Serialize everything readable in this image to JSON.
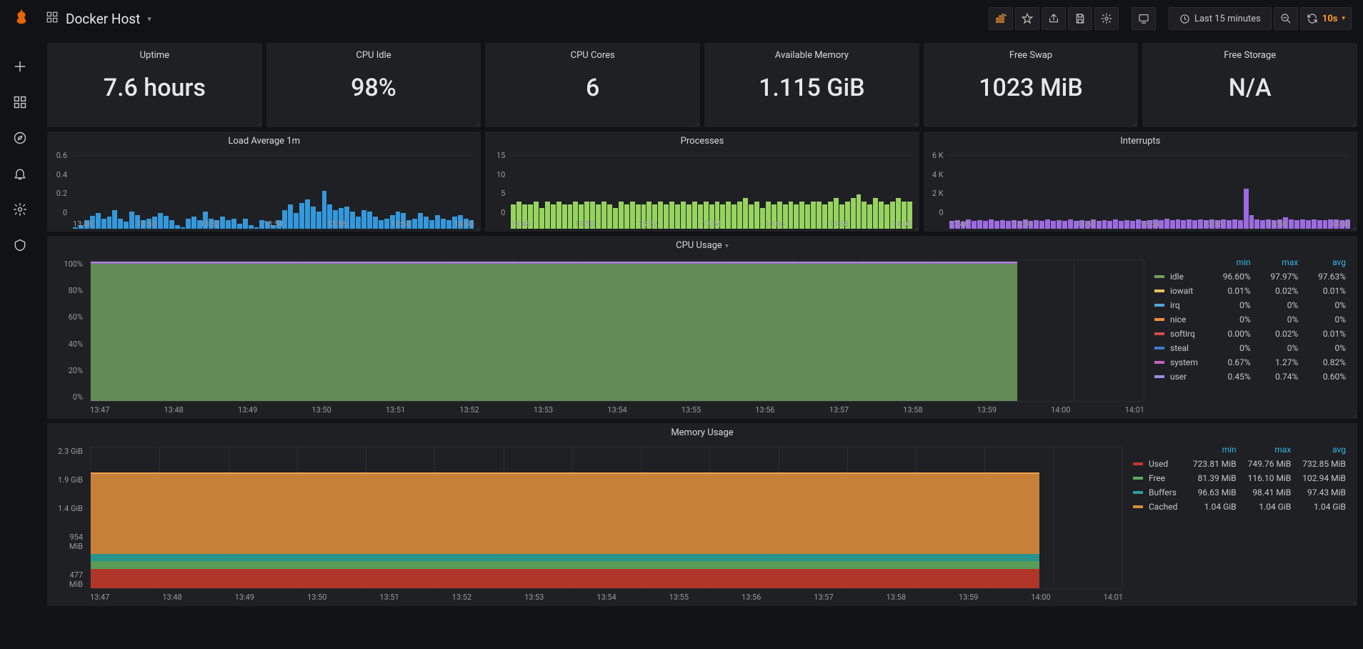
{
  "header": {
    "dashboard_title": "Docker Host",
    "time_range": "Last 15 minutes",
    "refresh_interval": "10s"
  },
  "stats": [
    {
      "title": "Uptime",
      "value": "7.6 hours"
    },
    {
      "title": "CPU Idle",
      "value": "98%"
    },
    {
      "title": "CPU Cores",
      "value": "6"
    },
    {
      "title": "Available Memory",
      "value": "1.115 GiB"
    },
    {
      "title": "Free Swap",
      "value": "1023 MiB"
    },
    {
      "title": "Free Storage",
      "value": "N/A"
    }
  ],
  "mini_panels": [
    {
      "title": "Load Average 1m",
      "color": "#3498db",
      "y_ticks": [
        "0",
        "0.2",
        "0.4",
        "0.6"
      ],
      "ymax": 0.6,
      "x_ticks": [
        "13:48",
        "13:50",
        "13:52",
        "13:54",
        "13:56",
        "13:58",
        "14:00"
      ]
    },
    {
      "title": "Processes",
      "color": "#96d45f",
      "y_ticks": [
        "0",
        "5",
        "10",
        "15"
      ],
      "ymax": 15,
      "x_ticks": [
        "13:48",
        "13:50",
        "13:52",
        "13:54",
        "13:56",
        "13:58",
        "14:00"
      ]
    },
    {
      "title": "Interrupts",
      "color": "#9b6bdf",
      "y_ticks": [
        "0",
        "2 K",
        "4 K",
        "6 K"
      ],
      "ymax": 6000,
      "x_ticks": [
        "13:48",
        "13:50",
        "13:52",
        "13:54",
        "13:56",
        "13:58",
        "14:00"
      ]
    }
  ],
  "cpu_panel": {
    "title": "CPU Usage",
    "y_ticks": [
      "0%",
      "20%",
      "40%",
      "60%",
      "80%",
      "100%"
    ],
    "x_ticks": [
      "13:47",
      "13:48",
      "13:49",
      "13:50",
      "13:51",
      "13:52",
      "13:53",
      "13:54",
      "13:55",
      "13:56",
      "13:57",
      "13:58",
      "13:59",
      "14:00",
      "14:01"
    ],
    "legend_headers": [
      "min",
      "max",
      "avg"
    ],
    "legend": [
      {
        "name": "idle",
        "color": "#6f9f5f",
        "min": "96.60%",
        "max": "97.97%",
        "avg": "97.63%"
      },
      {
        "name": "iowait",
        "color": "#e5c35c",
        "min": "0.01%",
        "max": "0.02%",
        "avg": "0.01%"
      },
      {
        "name": "irq",
        "color": "#56a7d6",
        "min": "0%",
        "max": "0%",
        "avg": "0%"
      },
      {
        "name": "nice",
        "color": "#f28e3b",
        "min": "0%",
        "max": "0%",
        "avg": "0%"
      },
      {
        "name": "softirq",
        "color": "#d04c4c",
        "min": "0.00%",
        "max": "0.02%",
        "avg": "0.01%"
      },
      {
        "name": "steal",
        "color": "#3d7ac9",
        "min": "0%",
        "max": "0%",
        "avg": "0%"
      },
      {
        "name": "system",
        "color": "#c266c2",
        "min": "0.67%",
        "max": "1.27%",
        "avg": "0.82%"
      },
      {
        "name": "user",
        "color": "#9b8fe0",
        "min": "0.45%",
        "max": "0.74%",
        "avg": "0.60%"
      }
    ]
  },
  "mem_panel": {
    "title": "Memory Usage",
    "y_ticks": [
      "477 MiB",
      "954 MiB",
      "1.4 GiB",
      "1.9 GiB",
      "2.3 GiB"
    ],
    "x_ticks": [
      "13:47",
      "13:48",
      "13:49",
      "13:50",
      "13:51",
      "13:52",
      "13:53",
      "13:54",
      "13:55",
      "13:56",
      "13:57",
      "13:58",
      "13:59",
      "14:00",
      "14:01"
    ],
    "legend_headers": [
      "min",
      "max",
      "avg"
    ],
    "legend": [
      {
        "name": "Used",
        "color": "#c0392b",
        "min": "723.81 MiB",
        "max": "749.76 MiB",
        "avg": "732.85 MiB"
      },
      {
        "name": "Free",
        "color": "#5fa85f",
        "min": "81.39 MiB",
        "max": "116.10 MiB",
        "avg": "102.94 MiB"
      },
      {
        "name": "Buffers",
        "color": "#2aa198",
        "min": "96.63 MiB",
        "max": "98.41 MiB",
        "avg": "97.43 MiB"
      },
      {
        "name": "Cached",
        "color": "#d98b3a",
        "min": "1.04 GiB",
        "max": "1.04 GiB",
        "avg": "1.04 GiB"
      }
    ]
  },
  "chart_data": [
    {
      "type": "bar",
      "title": "Load Average 1m",
      "ylim": [
        0,
        0.6
      ],
      "x_ticks": [
        "13:48",
        "13:50",
        "13:52",
        "13:54",
        "13:56",
        "13:58",
        "14:00"
      ],
      "values": [
        0.02,
        0.04,
        0.1,
        0.15,
        0.18,
        0.12,
        0.14,
        0.22,
        0.12,
        0.08,
        0.2,
        0.16,
        0.1,
        0.12,
        0.14,
        0.18,
        0.15,
        0.1,
        0.04,
        0.02,
        0.12,
        0.14,
        0.1,
        0.2,
        0.12,
        0.1,
        0.14,
        0.1,
        0.12,
        0.06,
        0.12,
        0.04,
        0.02,
        0.1,
        0.08,
        0.04,
        0.1,
        0.22,
        0.28,
        0.18,
        0.3,
        0.34,
        0.26,
        0.2,
        0.44,
        0.28,
        0.22,
        0.24,
        0.26,
        0.2,
        0.14,
        0.22,
        0.2,
        0.14,
        0.1,
        0.12,
        0.16,
        0.2,
        0.18,
        0.1,
        0.12,
        0.18,
        0.14,
        0.1,
        0.16,
        0.12,
        0.1,
        0.14,
        0.16,
        0.12,
        0.1
      ]
    },
    {
      "type": "bar",
      "title": "Processes",
      "ylim": [
        0,
        15
      ],
      "x_ticks": [
        "13:48",
        "13:50",
        "13:52",
        "13:54",
        "13:56",
        "13:58",
        "14:00"
      ],
      "values": [
        7,
        8,
        7,
        7,
        8,
        6,
        8,
        7,
        8,
        7,
        7,
        8,
        7,
        8,
        8,
        7,
        8,
        7,
        6,
        8,
        7,
        8,
        7,
        7,
        8,
        7,
        8,
        7,
        8,
        7,
        8,
        7,
        8,
        7,
        8,
        7,
        8,
        7,
        8,
        7,
        8,
        9,
        7,
        8,
        6,
        8,
        7,
        8,
        7,
        8,
        7,
        8,
        7,
        8,
        8,
        7,
        8,
        9,
        7,
        8,
        9,
        10,
        8,
        7,
        9,
        8,
        7,
        8,
        9,
        8,
        8
      ]
    },
    {
      "type": "bar",
      "title": "Interrupts",
      "ylim": [
        0,
        6000
      ],
      "x_ticks": [
        "13:48",
        "13:50",
        "13:52",
        "13:54",
        "13:56",
        "13:58",
        "14:00"
      ],
      "values": [
        900,
        1000,
        800,
        1100,
        900,
        1000,
        900,
        1100,
        900,
        1000,
        900,
        1000,
        900,
        1100,
        900,
        1000,
        900,
        1100,
        900,
        1000,
        900,
        1100,
        900,
        1000,
        900,
        1100,
        900,
        1000,
        900,
        1100,
        900,
        1000,
        900,
        1100,
        900,
        1000,
        1100,
        1000,
        1200,
        1000,
        1100,
        1000,
        1100,
        1000,
        1100,
        1000,
        1100,
        1000,
        1100,
        1000,
        1100,
        1000,
        4700,
        1600,
        1100,
        1000,
        1100,
        1000,
        1100,
        1300,
        1100,
        1000,
        1100,
        1000,
        1100,
        1000,
        1000,
        1100,
        1100,
        1000,
        1100
      ]
    },
    {
      "type": "area",
      "title": "CPU Usage",
      "ylim": [
        0,
        100
      ],
      "x_ticks": [
        "13:47",
        "13:48",
        "13:49",
        "13:50",
        "13:51",
        "13:52",
        "13:53",
        "13:54",
        "13:55",
        "13:56",
        "13:57",
        "13:58",
        "13:59",
        "14:00",
        "14:01"
      ],
      "series": [
        {
          "name": "idle",
          "value_pct": 97.63,
          "cum_top_pct": 97.63
        },
        {
          "name": "iowait",
          "value_pct": 0.01,
          "cum_top_pct": 97.64
        },
        {
          "name": "irq",
          "value_pct": 0,
          "cum_top_pct": 97.64
        },
        {
          "name": "nice",
          "value_pct": 0,
          "cum_top_pct": 97.64
        },
        {
          "name": "softirq",
          "value_pct": 0.01,
          "cum_top_pct": 97.65
        },
        {
          "name": "steal",
          "value_pct": 0,
          "cum_top_pct": 97.65
        },
        {
          "name": "system",
          "value_pct": 0.82,
          "cum_top_pct": 98.47
        },
        {
          "name": "user",
          "value_pct": 0.6,
          "cum_top_pct": 99.07
        }
      ],
      "time_coverage_pct": 88
    },
    {
      "type": "area",
      "title": "Memory Usage",
      "ylim_mib": [
        477,
        2355
      ],
      "x_ticks": [
        "13:47",
        "13:48",
        "13:49",
        "13:50",
        "13:51",
        "13:52",
        "13:53",
        "13:54",
        "13:55",
        "13:56",
        "13:57",
        "13:58",
        "13:59",
        "14:00",
        "14:01"
      ],
      "series": [
        {
          "name": "Used",
          "value_mib": 732.85,
          "cum_top_mib": 732.85
        },
        {
          "name": "Free",
          "value_mib": 102.94,
          "cum_top_mib": 835.79
        },
        {
          "name": "Buffers",
          "value_mib": 97.43,
          "cum_top_mib": 933.22
        },
        {
          "name": "Cached",
          "value_mib": 1064.96,
          "cum_top_mib": 1998.18
        }
      ],
      "time_coverage_pct": 92
    }
  ]
}
